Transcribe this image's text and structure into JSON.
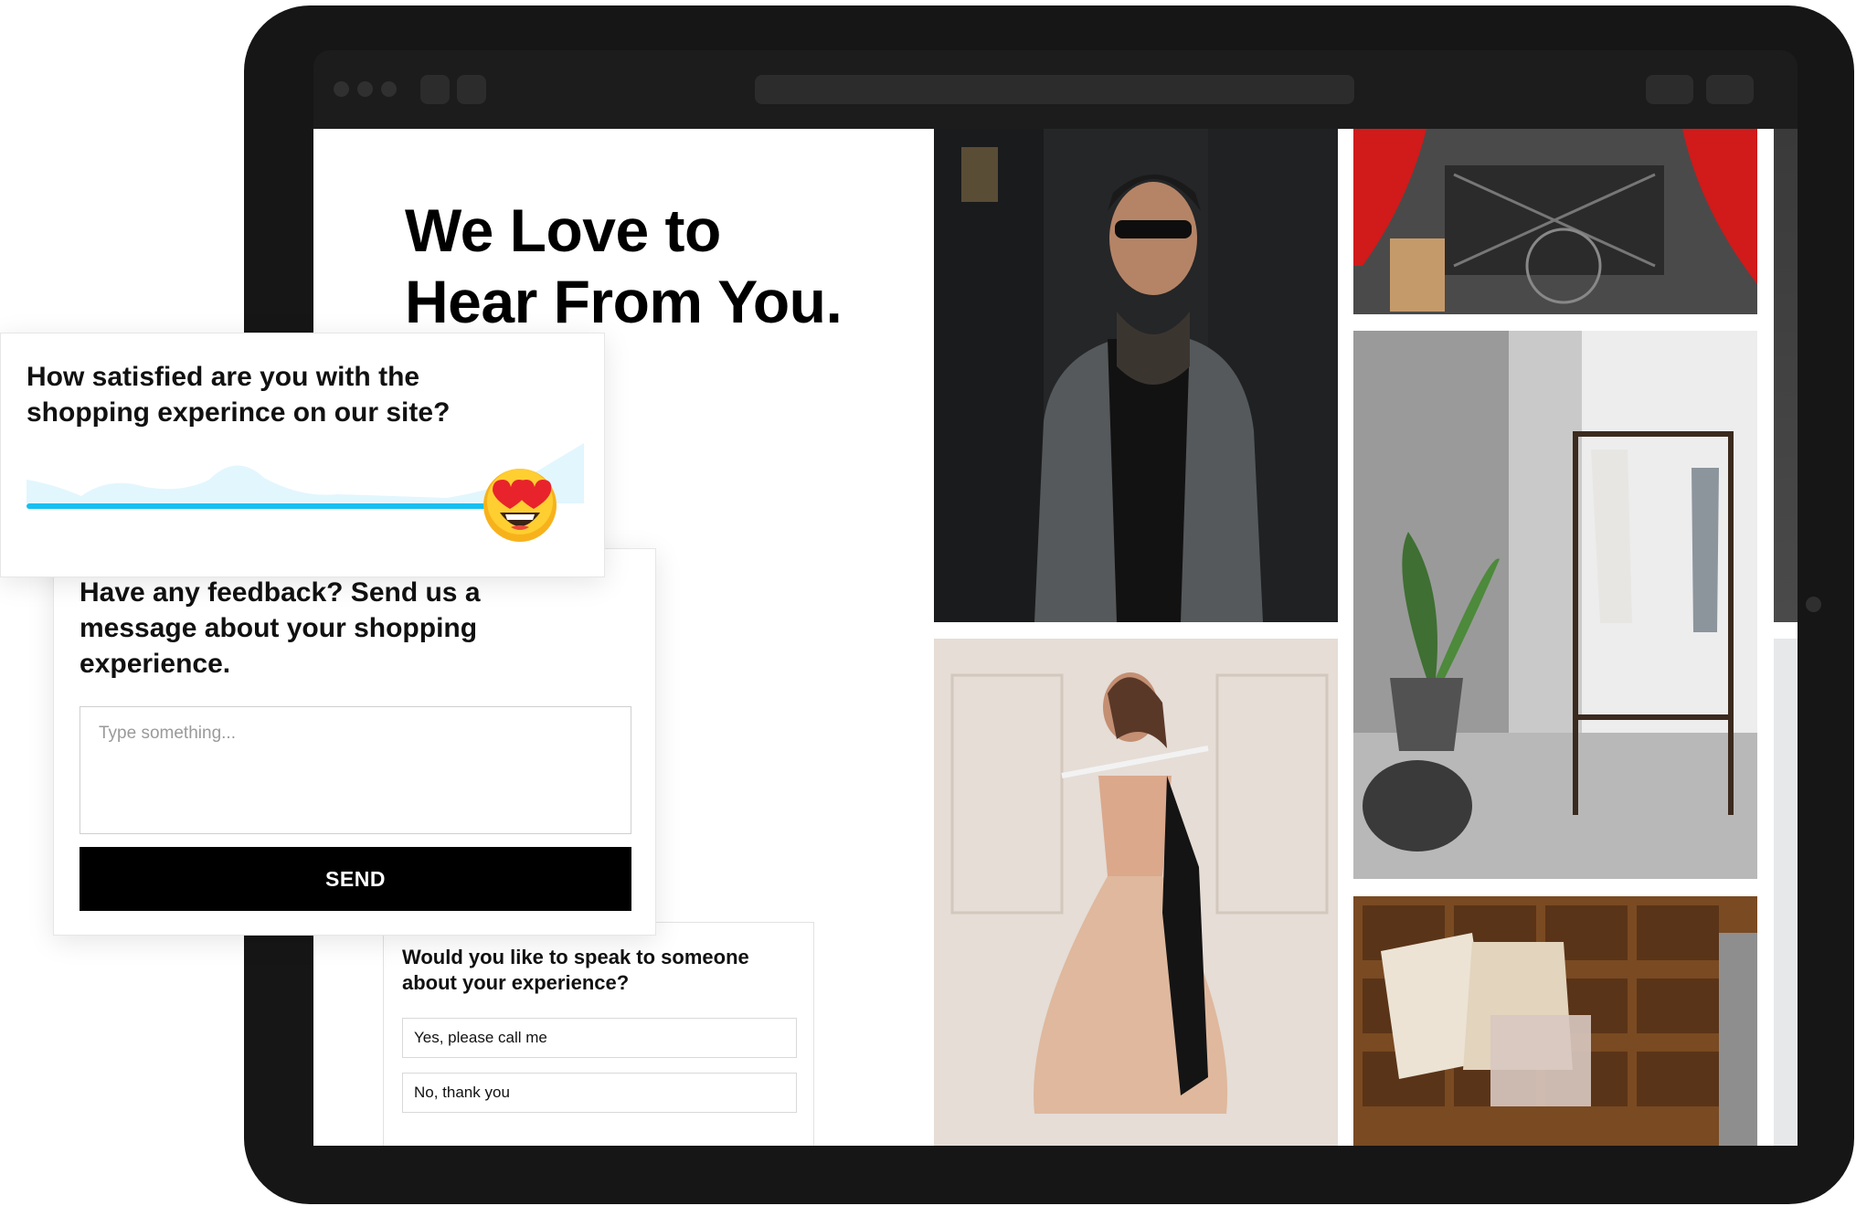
{
  "hero": {
    "title_line1": "We Love to",
    "title_line2": "Hear From You."
  },
  "satisfaction_survey": {
    "question": "How satisfied are you with the shopping experince on our site?",
    "slider_value_fraction": 0.95,
    "thumb_icon": "heart-eyes-emoji-icon"
  },
  "feedback_form": {
    "title": "Have any feedback? Send us a message about your shopping experience.",
    "input_placeholder": "Type something...",
    "send_label": "SEND"
  },
  "speak_survey": {
    "question": "Would you like to speak to someone about your experience?",
    "options": [
      {
        "label": "Yes, please call me"
      },
      {
        "label": "No, thank you"
      }
    ]
  },
  "colors": {
    "device": "#161616",
    "accent": "#17bff0",
    "button": "#000000"
  }
}
